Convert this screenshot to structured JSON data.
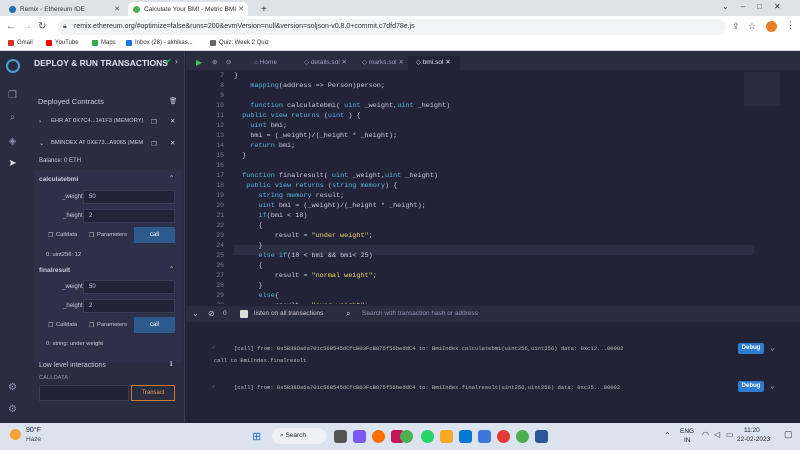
{
  "browser": {
    "tabs": [
      {
        "title": "Remix - Ethereum IDE",
        "active": false,
        "color": "#1e6fb5"
      },
      {
        "title": "Calculate Your BMI - Metric BMI",
        "active": true,
        "color": "#4caf50"
      }
    ],
    "url": "remix.ethereum.org/#optimize=false&runs=200&evmVersion=null&version=soljson-v0.8.0+commit.c7dfd78e.js",
    "bookmarks": [
      "Gmail",
      "YouTube",
      "Maps",
      "Inbox (28) - akhikas...",
      "Quiz: Week 2 Quiz"
    ]
  },
  "panel": {
    "title": "DEPLOY & RUN TRANSACTIONS",
    "deployed_title": "Deployed Contracts",
    "contract1": "EHR AT 0X7C4...141F3 (MEMORY)",
    "contract2": "BMINDEX AT 0XE73...A9065 (MEM",
    "balance": "Balance: 0 ETH",
    "fn1": {
      "name": "calculatebmi",
      "p1_label": "_weight",
      "p1_value": "50",
      "p2_label": "_height",
      "p2_value": "2",
      "calldata": "Calldata",
      "params": "Parameters",
      "call": "call",
      "output": "0: uint256: 12"
    },
    "fn2": {
      "name": "finalresult",
      "p1_label": "_weight",
      "p1_value": "50",
      "p2_label": "_height",
      "p2_value": "2",
      "calldata": "Calldata",
      "params": "Parameters",
      "call": "call",
      "output": "0: string: under weight"
    },
    "lowlevel": "Low level interactions",
    "calldata_label": "CALLDATA",
    "transact": "Transact"
  },
  "editor": {
    "tabs": [
      "Home",
      "details.sol",
      "marks.sol",
      "bmi.sol"
    ],
    "lines": [
      {
        "n": "7",
        "t": "}"
      },
      {
        "n": "8",
        "t": "    mapping(address => Person)person;"
      },
      {
        "n": "9",
        "t": ""
      },
      {
        "n": "10",
        "t": "    function calculatebmi( uint _weight,uint _height)"
      },
      {
        "n": "11",
        "t": "  public view returns (uint ) {"
      },
      {
        "n": "12",
        "t": "    uint bmi;"
      },
      {
        "n": "13",
        "t": "    bmi = (_weight)/(_height * _height);"
      },
      {
        "n": "14",
        "t": "    return bmi;"
      },
      {
        "n": "15",
        "t": "  }"
      },
      {
        "n": "16",
        "t": ""
      },
      {
        "n": "17",
        "t": "  function finalresult( uint _weight,uint _height)"
      },
      {
        "n": "18",
        "t": "   public view returns (string memory) {"
      },
      {
        "n": "19",
        "t": "      string memory result;"
      },
      {
        "n": "20",
        "t": "      uint bmi = (_weight)/(_height * _height);"
      },
      {
        "n": "21",
        "t": "      if(bmi < 18)"
      },
      {
        "n": "22",
        "t": "      {"
      },
      {
        "n": "23",
        "t": "          result = \"under weight\";"
      },
      {
        "n": "24",
        "t": "      }"
      },
      {
        "n": "25",
        "t": "      else if(18 < bmi && bmi< 25)"
      },
      {
        "n": "26",
        "t": "      {"
      },
      {
        "n": "27",
        "t": "          result = \"normal weight\";"
      },
      {
        "n": "28",
        "t": "      }"
      },
      {
        "n": "29",
        "t": "      else{"
      },
      {
        "n": "30",
        "t": "          result = \"over weight\";"
      }
    ]
  },
  "terminal": {
    "count": "0",
    "listen": "listen on all transactions",
    "search_placeholder": "Search with transaction hash or address",
    "log1": "[call]  from: 0x5B38Da6a701c568545dCfcB03FcB875f56beddC4 to: BmiIndex.calculatebmi(uint256,uint256) data: 0xc12...00002",
    "log1b": "call to BmiIndex.finalresult",
    "log2": "[call]  from: 0x5B38Da6a701c568545dCfcB03FcB875f56beddC4 to: BmiIndex.finalresult(uint256,uint256) data: 0xc35...00002",
    "debug": "Debug"
  },
  "taskbar": {
    "weather_temp": "90°F",
    "weather_desc": "Haze",
    "search": "Search",
    "lang1": "ENG",
    "lang2": "IN",
    "time": "11:20",
    "date": "22-02-2023"
  }
}
